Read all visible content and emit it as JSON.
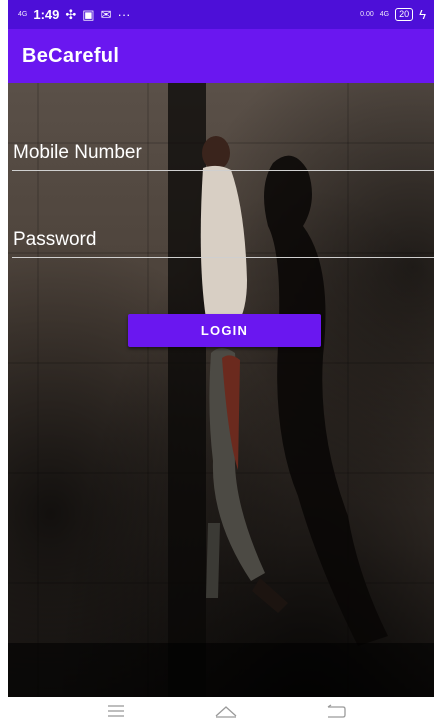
{
  "status_bar": {
    "signal_small": "4G",
    "time": "1:49",
    "icons": [
      "fan-icon",
      "gallery-icon",
      "mail-icon",
      "more-icon"
    ],
    "more": "···",
    "data_rate": "0.00",
    "network": "4G",
    "battery": "20"
  },
  "app_bar": {
    "title": "BeCareful"
  },
  "form": {
    "mobile_placeholder": "Mobile Number",
    "password_placeholder": "Password",
    "login_label": "LOGIN"
  },
  "nav_bar": {
    "buttons": [
      "menu-icon",
      "home-icon",
      "back-icon"
    ]
  },
  "colors": {
    "status_bar": "#4d0fd8",
    "app_bar": "#6a17f0",
    "button": "#6a17f0"
  }
}
